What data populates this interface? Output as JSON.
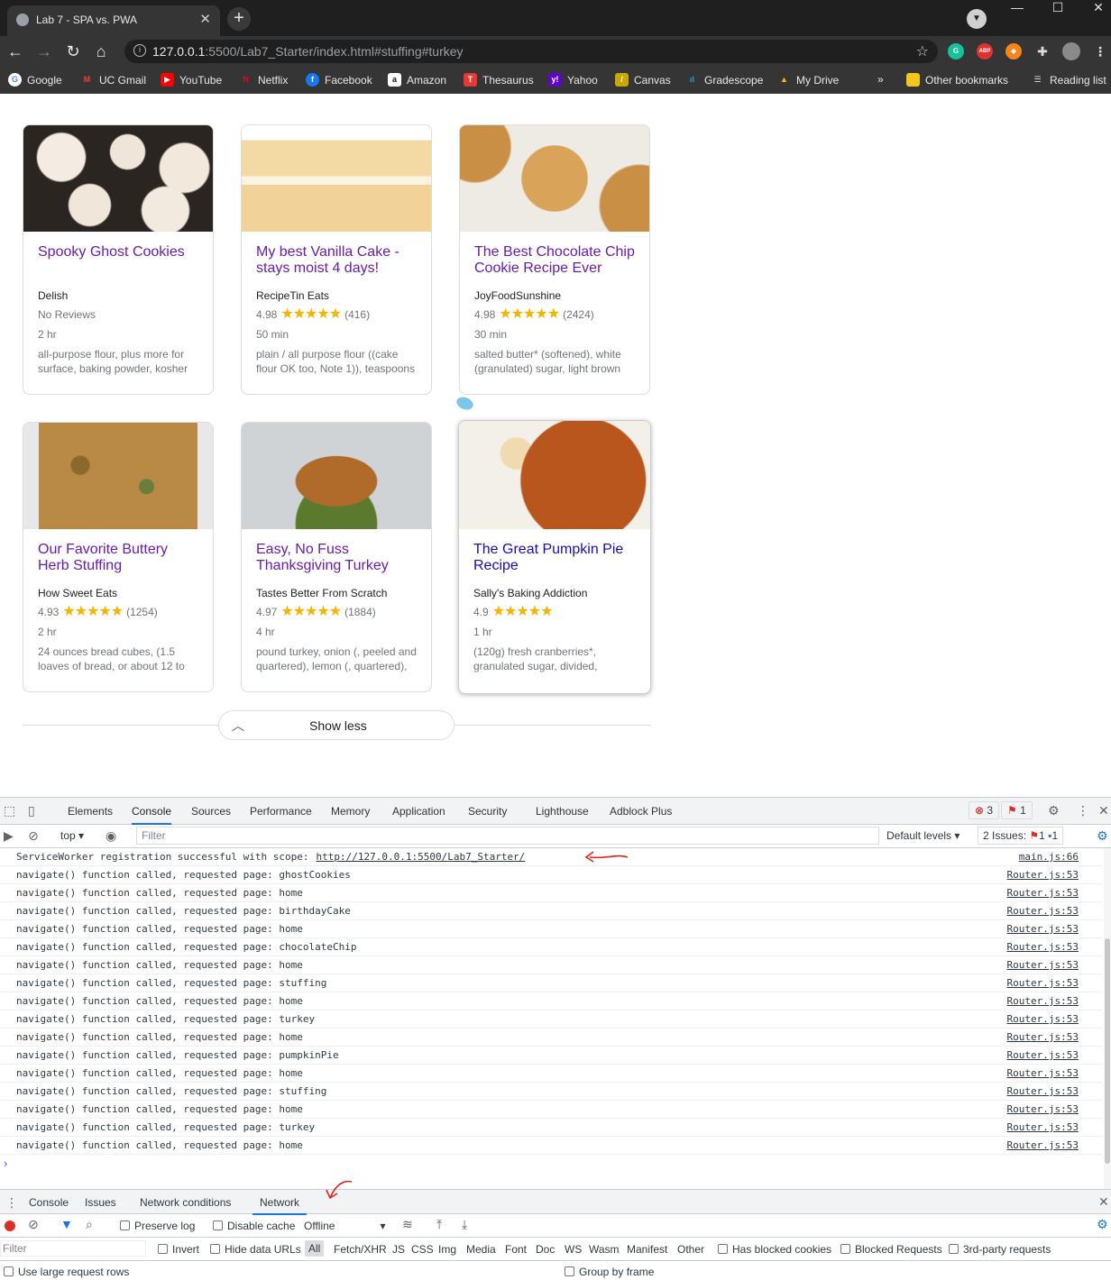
{
  "browser": {
    "tab_title": "Lab 7 - SPA vs. PWA",
    "url_host": "127.0.0.1",
    "url_rest": ":5500/Lab7_Starter/index.html#stuffing#turkey",
    "bookmarks": [
      "Google",
      "UC Gmail",
      "YouTube",
      "Netflix",
      "Facebook",
      "Amazon",
      "Thesaurus",
      "Yahoo",
      "Canvas",
      "Gradescope",
      "My Drive"
    ],
    "other_bookmarks": "Other bookmarks",
    "reading_list": "Reading list",
    "overflow": "»"
  },
  "recipes": [
    {
      "title": "Spooky Ghost Cookies",
      "source": "Delish",
      "rating": "No Reviews",
      "stars": "",
      "count": "",
      "time": "2 hr",
      "ingredients": "all-purpose flour, plus more for surface, baking powder, kosher"
    },
    {
      "title": "My best Vanilla Cake - stays moist 4 days!",
      "source": "RecipeTin Eats",
      "rating": "4.98",
      "stars": "★★★★★",
      "count": "(416)",
      "time": "50 min",
      "ingredients": "plain / all purpose flour ((cake flour OK too, Note 1)), teaspoons"
    },
    {
      "title": "The Best Chocolate Chip Cookie Recipe Ever",
      "source": "JoyFoodSunshine",
      "rating": "4.98",
      "stars": "★★★★★",
      "count": "(2424)",
      "time": "30 min",
      "ingredients": "salted butter* (softened), white (granulated) sugar, light brown"
    },
    {
      "title": "Our Favorite Buttery Herb Stuffing",
      "source": "How Sweet Eats",
      "rating": "4.93",
      "stars": "★★★★★",
      "count": "(1254)",
      "time": "2 hr",
      "ingredients": "24 ounces bread cubes, (1.5 loaves of bread, or about 12 to"
    },
    {
      "title": "Easy, No Fuss Thanksgiving Turkey",
      "source": "Tastes Better From Scratch",
      "rating": "4.97",
      "stars": "★★★★★",
      "count": "(1884)",
      "time": "4 hr",
      "ingredients": "pound turkey, onion (, peeled and quartered), lemon (, quartered),"
    },
    {
      "title": "The Great Pumpkin Pie Recipe",
      "source": "Sally's Baking Addiction",
      "rating": "4.9",
      "stars": "★★★★★",
      "count": "",
      "time": "1 hr",
      "ingredients": "(120g) fresh cranberries*, granulated sugar, divided,"
    }
  ],
  "show_less": "Show less",
  "devtools": {
    "tabs": [
      "Elements",
      "Console",
      "Sources",
      "Performance",
      "Memory",
      "Application",
      "Security",
      "Lighthouse",
      "Adblock Plus"
    ],
    "active_tab": "Console",
    "error_count": "3",
    "warning_count": "1",
    "context": "top",
    "filter_placeholder": "Filter",
    "levels": "Default levels",
    "issues_label": "2 Issues:",
    "issues_err": "1",
    "issues_info": "1",
    "sw_message": "ServiceWorker registration successful with scope:",
    "sw_scope": "http://127.0.0.1:5500/Lab7_Starter/",
    "sw_source": "main.js:66",
    "nav_prefix": "navigate() function called, requested page: ",
    "nav_source": "Router.js:53",
    "nav_pages": [
      "ghostCookies",
      "home",
      "birthdayCake",
      "home",
      "chocolateChip",
      "home",
      "stuffing",
      "home",
      "turkey",
      "home",
      "pumpkinPie",
      "home",
      "stuffing",
      "home",
      "turkey",
      "home"
    ],
    "prompt": "›",
    "drawer_tabs": [
      "Console",
      "Issues",
      "Network conditions",
      "Network"
    ],
    "drawer_active": "Network",
    "preserve_log": "Preserve log",
    "disable_cache": "Disable cache",
    "throttle": "Offline",
    "filter2": "Filter",
    "invert": "Invert",
    "hide_data_urls": "Hide data URLs",
    "types": [
      "All",
      "Fetch/XHR",
      "JS",
      "CSS",
      "Img",
      "Media",
      "Font",
      "Doc",
      "WS",
      "Wasm",
      "Manifest",
      "Other"
    ],
    "has_blocked_cookies": "Has blocked cookies",
    "blocked_requests": "Blocked Requests",
    "third_party": "3rd-party requests",
    "large_rows": "Use large request rows",
    "group_by_frame": "Group by frame"
  }
}
